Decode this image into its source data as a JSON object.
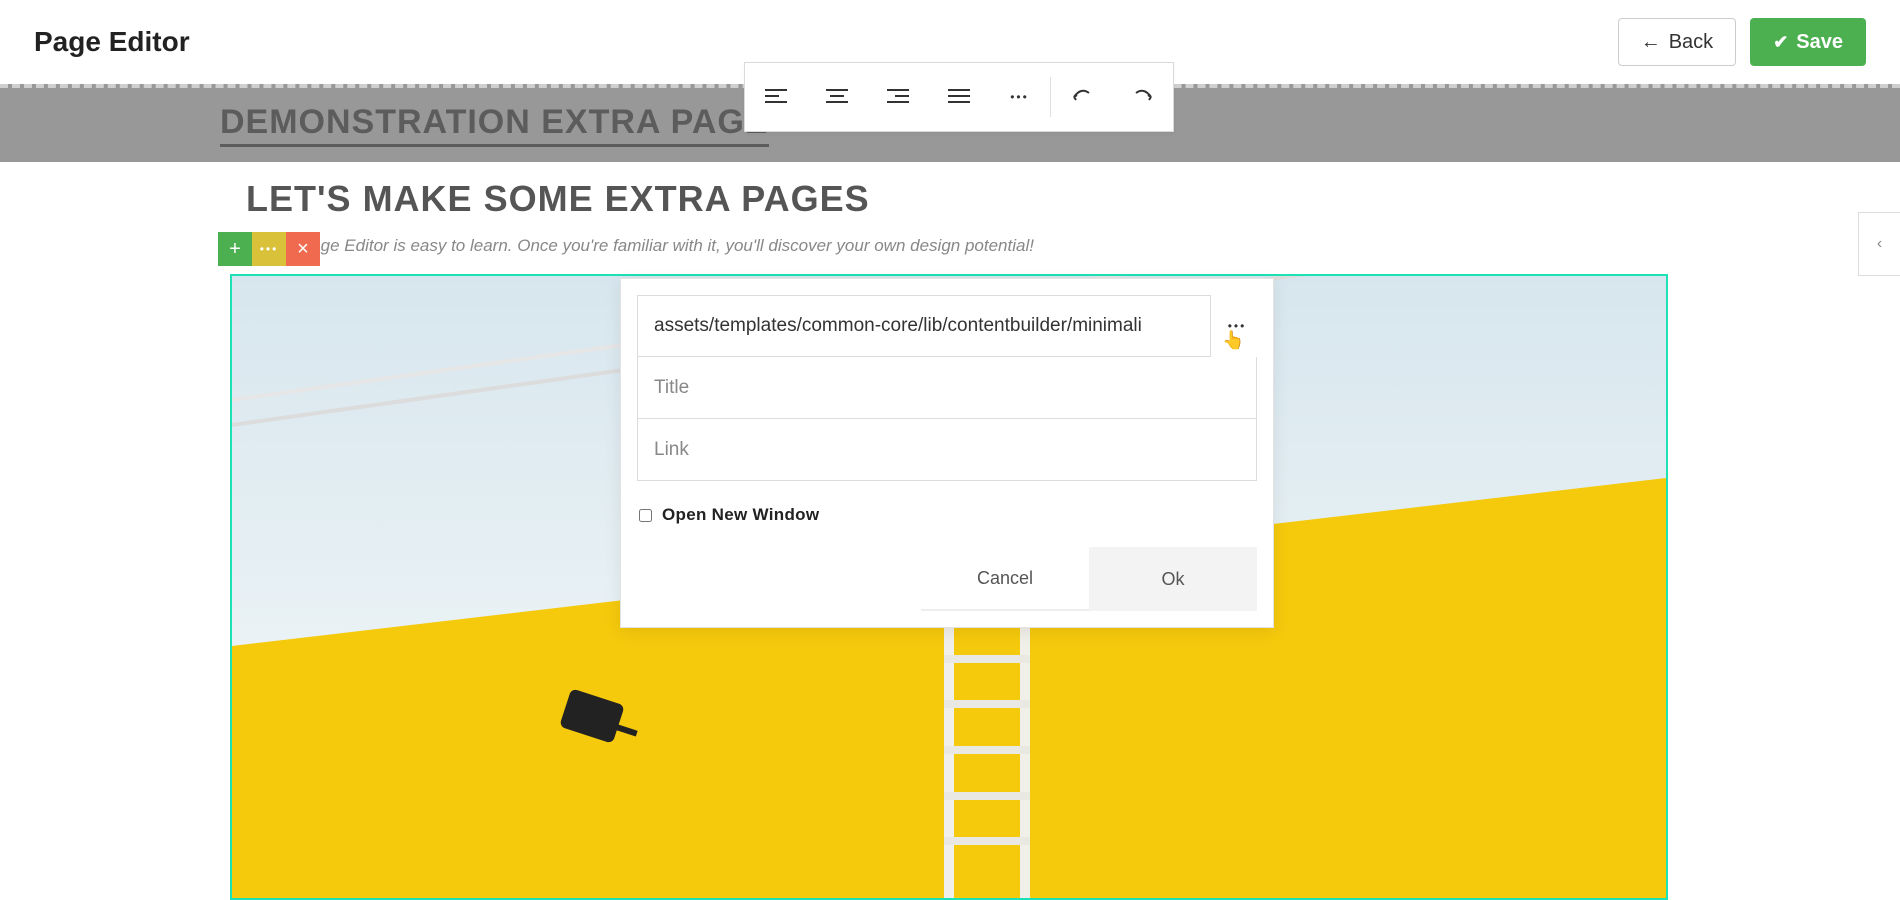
{
  "header": {
    "title": "Page Editor",
    "back_label": "Back",
    "save_label": "Save"
  },
  "banner": {
    "title": "DEMONSTRATION EXTRA PAGE"
  },
  "section": {
    "heading": "LET'S MAKE SOME EXTRA PAGES",
    "intro": "4Shop Page Editor is easy to learn. Once you're familiar with it, you'll discover your own design potential!"
  },
  "block_controls": {
    "add": "+",
    "more": "•••",
    "close": "×"
  },
  "format_toolbar": {
    "align_left": "align-left",
    "align_center": "align-center",
    "align_right": "align-right",
    "align_justify": "align-justify",
    "more": "•••",
    "undo": "undo",
    "redo": "redo"
  },
  "dialog": {
    "path_value": "assets/templates/common-core/lib/contentbuilder/minimali",
    "title_placeholder": "Title",
    "link_placeholder": "Link",
    "open_new_window_label": "Open New Window",
    "cancel_label": "Cancel",
    "ok_label": "Ok"
  },
  "side_tab": {
    "glyph": "‹"
  },
  "colors": {
    "accent_green": "#4caf50",
    "accent_teal": "#1de2b6",
    "wall_yellow": "#f5c90c"
  }
}
